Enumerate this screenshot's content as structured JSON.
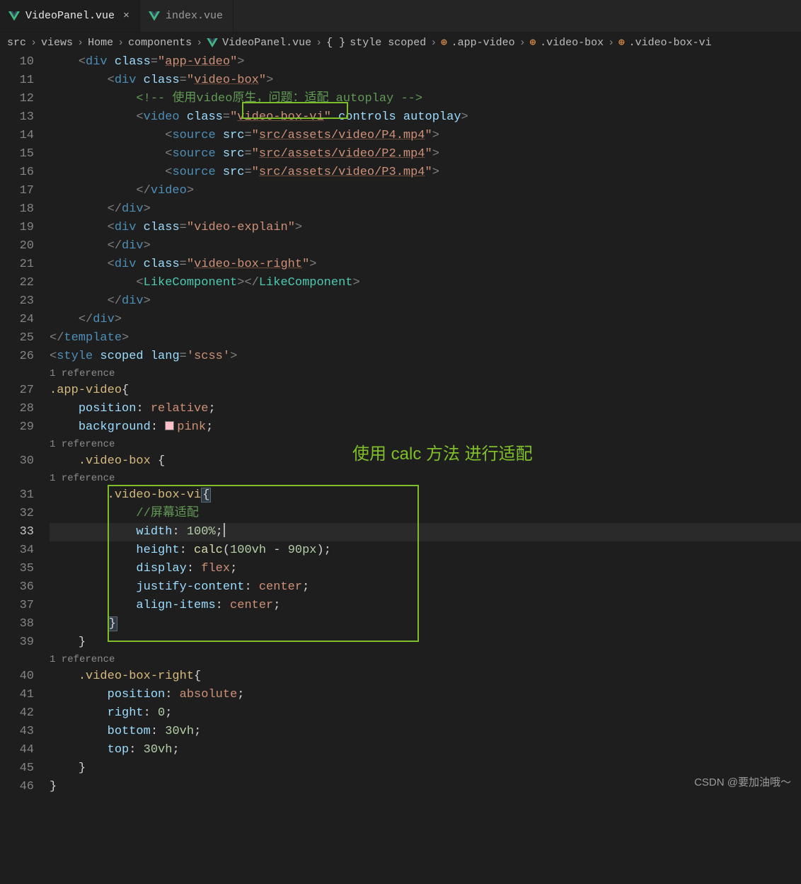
{
  "tabs": [
    {
      "label": "VideoPanel.vue",
      "active": true
    },
    {
      "label": "index.vue",
      "active": false
    }
  ],
  "breadcrumb": {
    "src": "src",
    "views": "views",
    "home": "Home",
    "components": "components",
    "file": "VideoPanel.vue",
    "style": "style scoped",
    "sel1": ".app-video",
    "sel2": ".video-box",
    "sel3": ".video-box-vi"
  },
  "lines": {
    "start": 10,
    "end": 46,
    "current": 33
  },
  "code": {
    "l10": {
      "cls": "app-video"
    },
    "l11": {
      "cls": "video-box"
    },
    "l12": {
      "cmt_pre": "使用video原生，问题：适配 autoplay"
    },
    "l13": {
      "cls": "video-box-vi",
      "attrs": "controls autoplay"
    },
    "l14": {
      "src": "src/assets/video/P4.mp4"
    },
    "l15": {
      "src": "src/assets/video/P2.mp4"
    },
    "l16": {
      "src": "src/assets/video/P3.mp4"
    },
    "l19": {
      "cls": "video-explain"
    },
    "l21": {
      "cls": "video-box-right"
    },
    "l22": {
      "comp": "LikeComponent"
    },
    "l26": {
      "lang": "scss"
    },
    "refs": "1 reference",
    "s_app": ".app-video",
    "p_pos": "position",
    "v_rel": "relative",
    "p_bg": "background",
    "v_pink": "pink",
    "s_vb": ".video-box",
    "s_vbvi": ".video-box-vi",
    "cmt_fit": "//屏幕适配",
    "p_w": "width",
    "v_100p": "100%",
    "p_h": "height",
    "fn_calc": "calc",
    "v_calc_a": "100vh",
    "v_calc_b": "90px",
    "p_disp": "display",
    "v_flex": "flex",
    "p_jc": "justify-content",
    "v_center": "center",
    "p_ai": "align-items",
    "s_vbr": ".video-box-right",
    "v_abs": "absolute",
    "p_r": "right",
    "v_0": "0",
    "p_b": "bottom",
    "v_30vh": "30vh",
    "p_t": "top"
  },
  "annotation": "使用 calc 方法 进行适配",
  "watermark": "CSDN @要加油哦～"
}
